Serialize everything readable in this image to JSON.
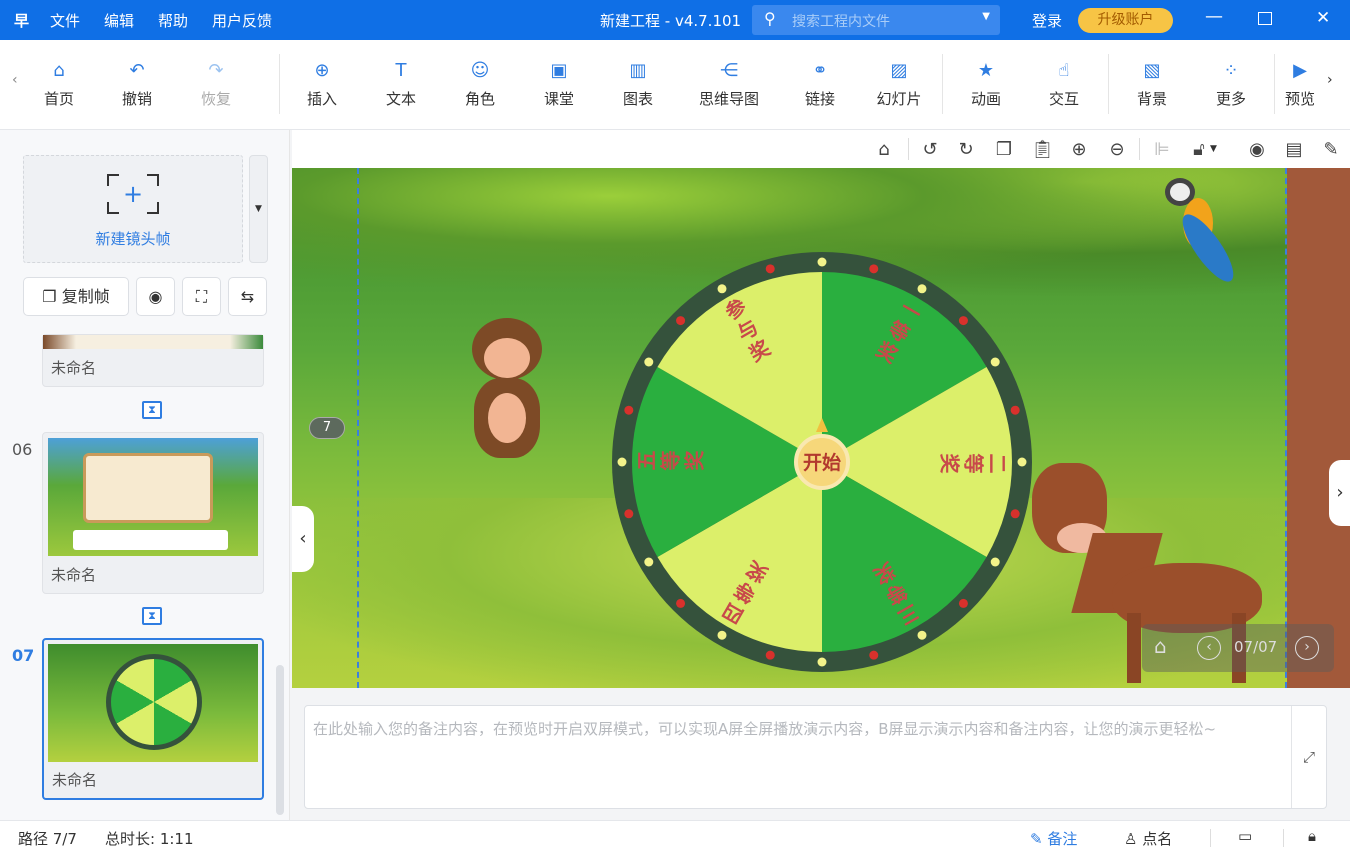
{
  "titlebar": {
    "logo": "早",
    "menus": [
      "文件",
      "编辑",
      "帮助",
      "用户反馈"
    ],
    "title": "新建工程 - v4.7.101",
    "search_placeholder": "搜索工程内文件",
    "login": "登录",
    "upgrade": "升级账户",
    "accent": "#0f6fe6"
  },
  "toolbar": {
    "items": [
      {
        "label": "首页",
        "icon": "home-icon",
        "glyph": "⌂"
      },
      {
        "label": "撤销",
        "icon": "undo-icon",
        "glyph": "↶"
      },
      {
        "label": "恢复",
        "icon": "redo-icon",
        "glyph": "↷",
        "disabled": true
      },
      {
        "label": "插入",
        "icon": "insert-icon",
        "glyph": "⊕"
      },
      {
        "label": "文本",
        "icon": "text-icon",
        "glyph": "T"
      },
      {
        "label": "角色",
        "icon": "character-icon",
        "glyph": "☺"
      },
      {
        "label": "课堂",
        "icon": "classroom-icon",
        "glyph": "▣"
      },
      {
        "label": "图表",
        "icon": "chart-icon",
        "glyph": "▥"
      },
      {
        "label": "思维导图",
        "icon": "mindmap-icon",
        "glyph": "⋲"
      },
      {
        "label": "链接",
        "icon": "link-icon",
        "glyph": "⚭"
      },
      {
        "label": "幻灯片",
        "icon": "slide-icon",
        "glyph": "▨"
      },
      {
        "label": "动画",
        "icon": "animation-icon",
        "glyph": "★"
      },
      {
        "label": "交互",
        "icon": "interact-icon",
        "glyph": "☝"
      },
      {
        "label": "背景",
        "icon": "background-icon",
        "glyph": "▧"
      },
      {
        "label": "更多",
        "icon": "more-icon",
        "glyph": "⁘"
      },
      {
        "label": "预览",
        "icon": "preview-icon",
        "glyph": "▶"
      }
    ]
  },
  "left": {
    "new_frame": "新建镜头帧",
    "copy_frame": "复制帧",
    "frames": [
      {
        "num": "",
        "name": "未命名"
      },
      {
        "num": "06",
        "name": "未命名"
      },
      {
        "num": "07",
        "name": "未命名",
        "selected": true
      }
    ]
  },
  "canvas": {
    "frame_badge": "7",
    "page_indicator": "07/07"
  },
  "wheel": {
    "center_label": "开始",
    "segments": [
      {
        "label": "一等奖",
        "color": "#2aaf3f"
      },
      {
        "label": "二等奖",
        "color": "#dcef6a"
      },
      {
        "label": "三等奖",
        "color": "#2aaf3f"
      },
      {
        "label": "四等奖",
        "color": "#dcef6a"
      },
      {
        "label": "五等奖",
        "color": "#2aaf3f"
      },
      {
        "label": "参与奖",
        "color": "#dcef6a"
      }
    ],
    "rim_color": "#35523c",
    "text_color": "#c8494a"
  },
  "notes": {
    "placeholder": "在此处输入您的备注内容，在预览时开启双屏模式，可以实现A屏全屏播放演示内容，B屏显示演示内容和备注内容，让您的演示更轻松~"
  },
  "status": {
    "path": "路径 7/7",
    "duration": "总时长: 1:11",
    "notes": "备注",
    "rollcall": "点名"
  }
}
